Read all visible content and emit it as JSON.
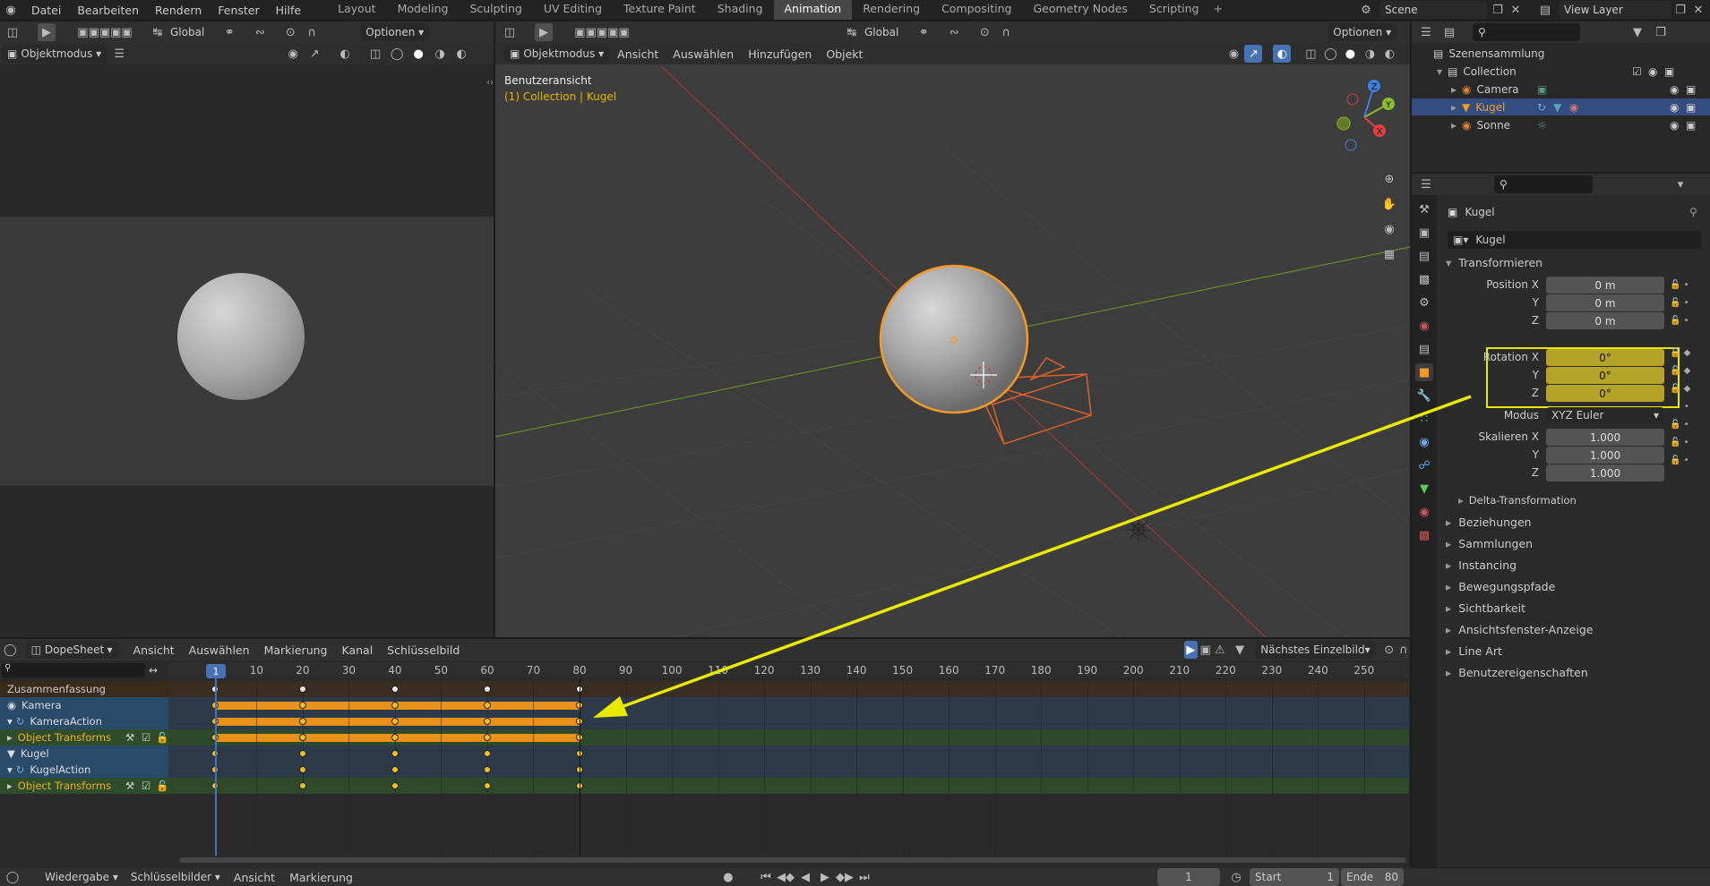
{
  "topbar": {
    "menus": [
      "Datei",
      "Bearbeiten",
      "Rendern",
      "Fenster",
      "Hilfe"
    ],
    "workspaces": [
      "Layout",
      "Modeling",
      "Sculpting",
      "UV Editing",
      "Texture Paint",
      "Shading",
      "Animation",
      "Rendering",
      "Compositing",
      "Geometry Nodes",
      "Scripting"
    ],
    "active_workspace": "Animation",
    "scene": "Scene",
    "view_layer": "View Layer"
  },
  "left_view": {
    "mode": "Objektmodus",
    "orientation": "Global",
    "options": "Optionen"
  },
  "viewport": {
    "mode": "Objektmodus",
    "menus": [
      "Ansicht",
      "Auswählen",
      "Hinzufügen",
      "Objekt"
    ],
    "orientation": "Global",
    "options": "Optionen",
    "view_name": "Benutzeransicht",
    "context": "(1) Collection | Kugel",
    "gizmo": {
      "x": "X",
      "y": "Y",
      "z": "Z"
    }
  },
  "outliner": {
    "root": "Szenensammlung",
    "collection": "Collection",
    "items": [
      {
        "name": "Camera",
        "selected": false
      },
      {
        "name": "Kugel",
        "selected": true
      },
      {
        "name": "Sonne",
        "selected": false
      }
    ]
  },
  "properties": {
    "object_name": "Kugel",
    "object_field": "Kugel",
    "transform_header": "Transformieren",
    "location": {
      "label": "Position X",
      "y_label": "Y",
      "z_label": "Z",
      "x": "0 m",
      "y": "0 m",
      "z": "0 m"
    },
    "rotation": {
      "label": "Rotation X",
      "y_label": "Y",
      "z_label": "Z",
      "x": "0°",
      "y": "0°",
      "z": "0°"
    },
    "mode_label": "Modus",
    "mode_value": "XYZ Euler",
    "scale": {
      "label": "Skalieren X",
      "y_label": "Y",
      "z_label": "Z",
      "x": "1.000",
      "y": "1.000",
      "z": "1.000"
    },
    "delta": "Delta-Transformation",
    "sections": [
      "Beziehungen",
      "Sammlungen",
      "Instancing",
      "Bewegungspfade",
      "Sichtbarkeit",
      "Ansichtsfenster-Anzeige",
      "Line Art",
      "Benutzereigenschaften"
    ]
  },
  "dopesheet": {
    "editor": "DopeSheet",
    "menus": [
      "Ansicht",
      "Auswählen",
      "Markierung",
      "Kanal",
      "Schlüsselbild"
    ],
    "snap": "Nächstes Einzelbild",
    "current_frame_label": "1",
    "ruler": [
      "10",
      "20",
      "30",
      "40",
      "50",
      "60",
      "70",
      "80",
      "90",
      "100",
      "110",
      "120",
      "130",
      "140",
      "150",
      "160",
      "170",
      "180",
      "190",
      "200",
      "210",
      "220",
      "230",
      "240",
      "250"
    ],
    "channels": [
      {
        "label": "Zusammenfassung",
        "kind": "summary"
      },
      {
        "label": "Kamera",
        "kind": "object"
      },
      {
        "label": "KameraAction",
        "kind": "action"
      },
      {
        "label": "Object Transforms",
        "kind": "group"
      },
      {
        "label": "Kugel",
        "kind": "object"
      },
      {
        "label": "KugelAction",
        "kind": "action"
      },
      {
        "label": "Object Transforms",
        "kind": "group"
      }
    ],
    "keyframes": [
      1,
      20,
      40,
      60,
      80
    ]
  },
  "timeline": {
    "menus": [
      "Wiedergabe",
      "Schlüsselbilder",
      "Ansicht",
      "Markierung"
    ],
    "current_frame": "1",
    "start_label": "Start",
    "start": "1",
    "end_label": "Ende",
    "end": "80"
  },
  "colors": {
    "accent_yellow": "#e8e800",
    "select_orange": "#f59a23",
    "channel_blue": "#2a4a6a",
    "group_green": "#2e4d2a",
    "keyframe_bar": "#e8921a"
  }
}
